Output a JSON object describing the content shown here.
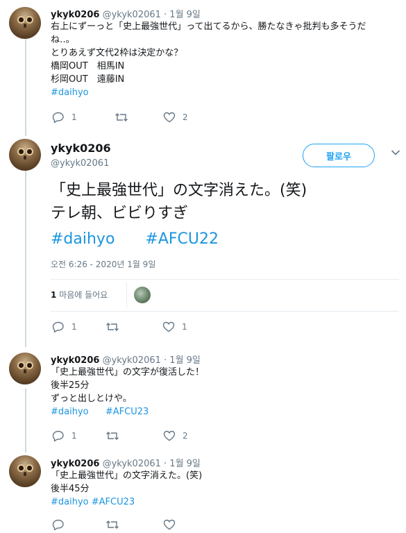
{
  "tweet1": {
    "name": "ykyk0206",
    "meta": "@ykyk02061 · 1월 9일",
    "lines": [
      "右上にずーっと「史上最強世代」って出てるから、勝たなきゃ批判も多そうだ",
      "ね‥。",
      "とりあえず文代2枠は決定かな？",
      "橋岡OUT　相馬IN",
      "杉岡OUT　遠藤IN"
    ],
    "hashtag": "#daihyo",
    "reply_count": "1",
    "retweet_count": "",
    "like_count": "2"
  },
  "main": {
    "name": "ykyk0206",
    "handle": "@ykyk02061",
    "follow_label": "팔로우",
    "line1": "「史上最強世代」の文字消えた。(笑)",
    "line2": "テレ朝、ビビりすぎ",
    "hashtag1": "#daihyo",
    "hashtag2": "#AFCU22",
    "timestamp": "오전 6:26 - 2020년 1월 9일",
    "likes_count": "1",
    "likes_label": "마음에 들어요",
    "reply_count": "1",
    "retweet_count": "",
    "like_count": "1"
  },
  "tweet3": {
    "name": "ykyk0206",
    "meta": "@ykyk02061 · 1월 9일",
    "lines": [
      "「史上最強世代」の文字が復活した！",
      "後半25分",
      "ずっと出しとけや。"
    ],
    "hashtag1": "#daihyo",
    "hashtag2": "#AFCU23",
    "reply_count": "1",
    "retweet_count": "",
    "like_count": "2"
  },
  "tweet4": {
    "name": "ykyk0206",
    "meta": "@ykyk02061 · 1월 9일",
    "lines": [
      "「史上最強世代」の文字消えた。(笑)",
      "後半45分"
    ],
    "hashtag1": "#daihyo",
    "hashtag2": "#AFCU23"
  },
  "colors": {
    "link": "#1b95e0",
    "follow": "#1da1f2",
    "meta": "#657786",
    "thread": "#cfd9de"
  }
}
